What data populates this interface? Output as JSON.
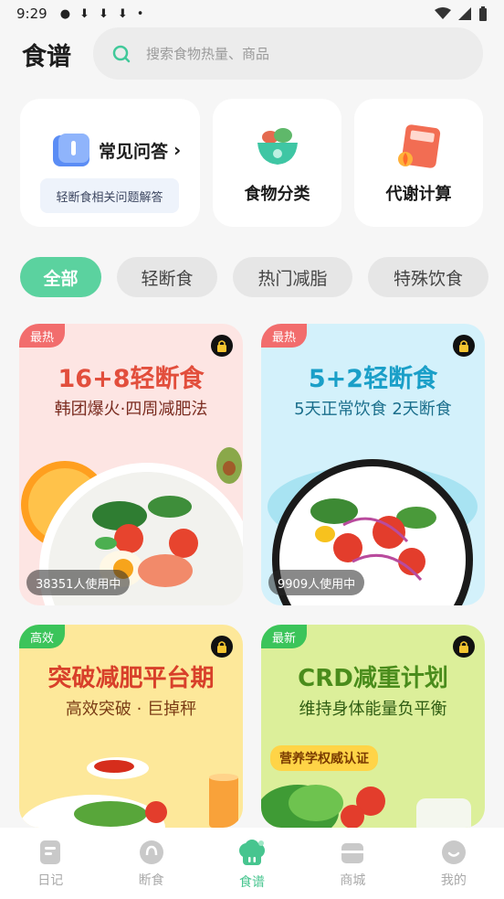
{
  "status_bar": {
    "time": "9:29"
  },
  "header": {
    "title": "食谱",
    "search_placeholder": "搜索食物热量、商品"
  },
  "quick_cards": {
    "faq": {
      "title": "常见问答",
      "subtitle": "轻断食相关问题解答"
    },
    "category": {
      "label": "食物分类"
    },
    "metabolism": {
      "label": "代谢计算"
    }
  },
  "filters": [
    {
      "label": "全部",
      "active": true
    },
    {
      "label": "轻断食",
      "active": false
    },
    {
      "label": "热门减脂",
      "active": false
    },
    {
      "label": "特殊饮食",
      "active": false
    }
  ],
  "plans": [
    {
      "tag": "最热",
      "title": "16+8轻断食",
      "subtitle": "韩团爆火·四周减肥法",
      "users": "38351人使用中"
    },
    {
      "tag": "最热",
      "title": "5+2轻断食",
      "subtitle": "5天正常饮食 2天断食",
      "users": "9909人使用中"
    },
    {
      "tag": "高效",
      "title": "突破减肥平台期",
      "subtitle": "高效突破 · 巨掉秤"
    },
    {
      "tag": "最新",
      "title": "CRD减重计划",
      "subtitle": "维持身体能量负平衡",
      "badge": "营养学权威认证"
    }
  ],
  "bottom_nav": [
    {
      "label": "日记",
      "active": false
    },
    {
      "label": "断食",
      "active": false
    },
    {
      "label": "食谱",
      "active": true
    },
    {
      "label": "商城",
      "active": false
    },
    {
      "label": "我的",
      "active": false
    }
  ],
  "colors": {
    "accent_green": "#5bd29f",
    "tag_red": "#f26d6d",
    "tag_green": "#3bc45a",
    "plan1_bg": "#fde5e3",
    "plan2_bg": "#d3f1fb",
    "plan3_bg": "#fde89a",
    "plan4_bg": "#dcef9a"
  }
}
